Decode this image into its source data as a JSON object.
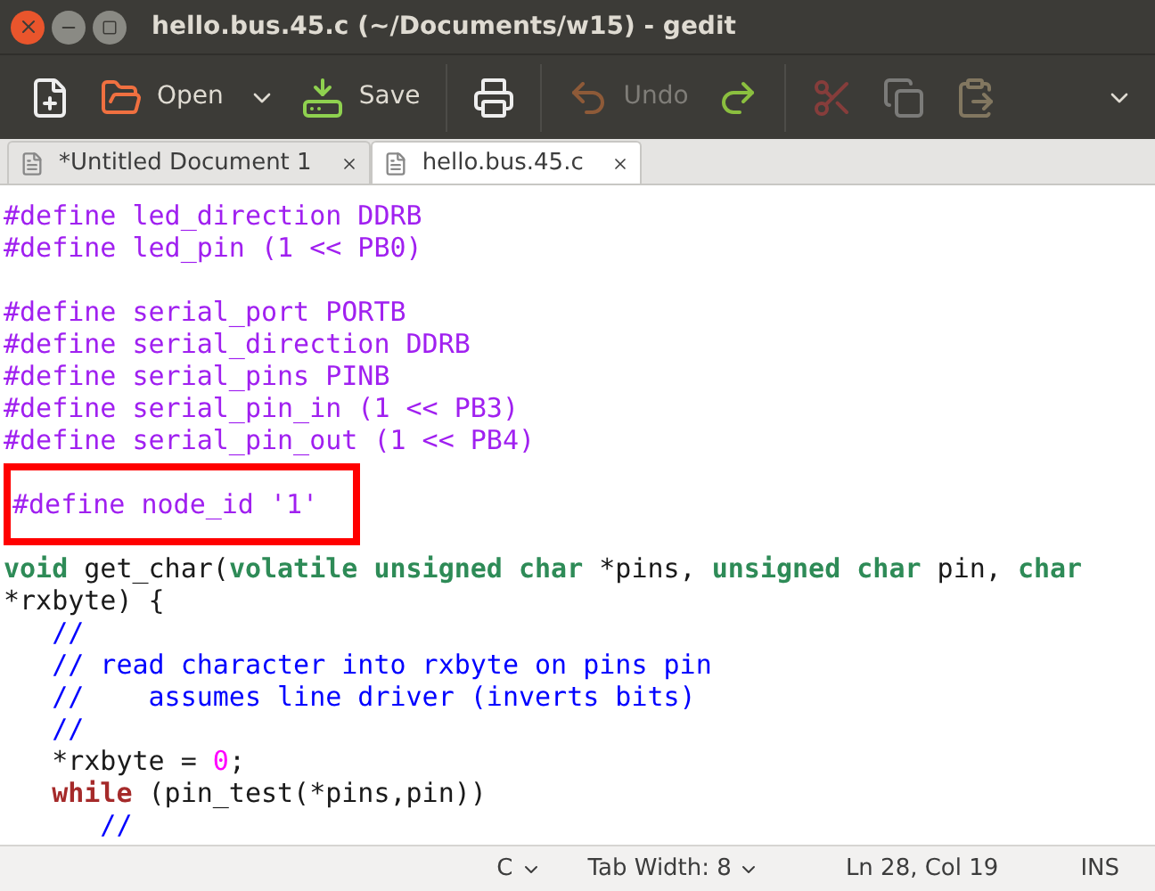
{
  "window": {
    "title": "hello.bus.45.c (~/Documents/w15) - gedit"
  },
  "toolbar": [
    {
      "kind": "new",
      "disabled": false
    },
    {
      "kind": "open",
      "label": "Open",
      "disabled": false
    },
    {
      "kind": "save",
      "label": "Save",
      "disabled": false
    },
    {
      "kind": "print",
      "disabled": false
    },
    {
      "kind": "undo",
      "label": "Undo",
      "disabled": true
    },
    {
      "kind": "redo",
      "disabled": false
    },
    {
      "kind": "cut",
      "disabled": true
    },
    {
      "kind": "copy",
      "disabled": true
    },
    {
      "kind": "paste",
      "disabled": true
    }
  ],
  "tabs": [
    {
      "label": "*Untitled Document 1",
      "selected": false
    },
    {
      "label": "hello.bus.45.c",
      "selected": true
    }
  ],
  "code": [
    {
      "kind": "code",
      "segments": [
        {
          "kind": "preproc",
          "text": "#define led_direction DDRB"
        }
      ]
    },
    {
      "kind": "code",
      "segments": [
        {
          "kind": "preproc",
          "text": "#define led_pin (1 << PB0)"
        }
      ]
    },
    {
      "kind": "blank"
    },
    {
      "kind": "code",
      "segments": [
        {
          "kind": "preproc",
          "text": "#define serial_port PORTB"
        }
      ]
    },
    {
      "kind": "code",
      "segments": [
        {
          "kind": "preproc",
          "text": "#define serial_direction DDRB"
        }
      ]
    },
    {
      "kind": "code",
      "segments": [
        {
          "kind": "preproc",
          "text": "#define serial_pins PINB"
        }
      ]
    },
    {
      "kind": "code",
      "segments": [
        {
          "kind": "preproc",
          "text": "#define serial_pin_in (1 << PB3)"
        }
      ]
    },
    {
      "kind": "code",
      "segments": [
        {
          "kind": "preproc",
          "text": "#define serial_pin_out (1 << PB4)"
        }
      ]
    },
    {
      "kind": "blank"
    },
    {
      "kind": "code",
      "highlighted": true,
      "segments": [
        {
          "kind": "preproc",
          "text": "#define node_id '1'"
        }
      ]
    },
    {
      "kind": "blank"
    },
    {
      "kind": "code",
      "segments": [
        {
          "kind": "type",
          "text": "void"
        },
        {
          "kind": "plain",
          "text": " get_char("
        },
        {
          "kind": "type",
          "text": "volatile unsigned char"
        },
        {
          "kind": "plain",
          "text": " *pins, "
        },
        {
          "kind": "type",
          "text": "unsigned char"
        },
        {
          "kind": "plain",
          "text": " pin, "
        },
        {
          "kind": "type",
          "text": "char"
        }
      ]
    },
    {
      "kind": "code",
      "segments": [
        {
          "kind": "plain",
          "text": "*rxbyte) {"
        }
      ]
    },
    {
      "kind": "code",
      "segments": [
        {
          "kind": "comment",
          "text": "   //"
        }
      ]
    },
    {
      "kind": "code",
      "segments": [
        {
          "kind": "comment",
          "text": "   // read character into rxbyte on pins pin"
        }
      ]
    },
    {
      "kind": "code",
      "segments": [
        {
          "kind": "comment",
          "text": "   //    assumes line driver (inverts bits)"
        }
      ]
    },
    {
      "kind": "code",
      "segments": [
        {
          "kind": "comment",
          "text": "   //"
        }
      ]
    },
    {
      "kind": "code",
      "segments": [
        {
          "kind": "plain",
          "text": "   *rxbyte = "
        },
        {
          "kind": "number",
          "text": "0"
        },
        {
          "kind": "plain",
          "text": ";"
        }
      ]
    },
    {
      "kind": "code",
      "segments": [
        {
          "kind": "keyword",
          "text": "   while"
        },
        {
          "kind": "plain",
          "text": " (pin_test(*pins,pin))"
        }
      ]
    },
    {
      "kind": "code",
      "segments": [
        {
          "kind": "comment",
          "text": "      //"
        }
      ]
    }
  ],
  "status_bar": {
    "language": "C",
    "tab_width": "Tab Width: 8",
    "position": "Ln 28, Col 19",
    "mode": "INS"
  }
}
